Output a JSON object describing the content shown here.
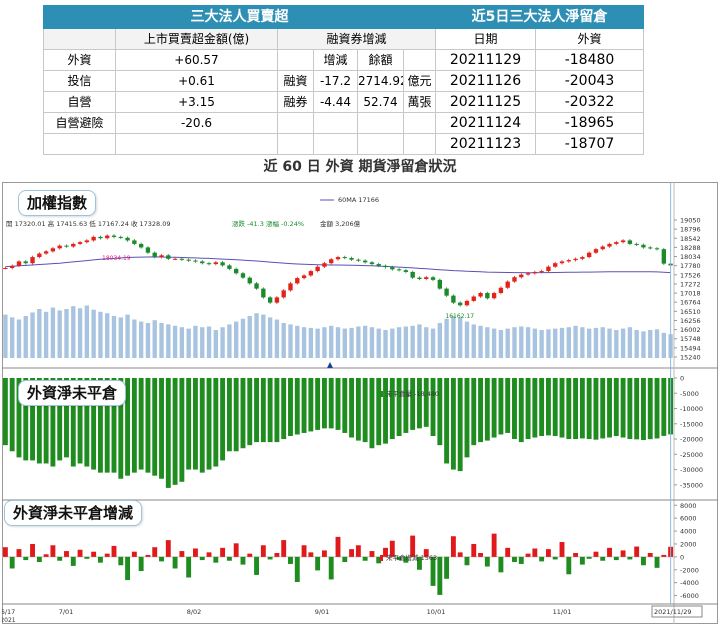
{
  "left_table": {
    "title": "三大法人買賣超",
    "col1_header": "上市買賣超金額(億)",
    "col2_header": "融資券增減",
    "sub_headers": [
      "增減",
      "餘額"
    ],
    "rows": [
      {
        "name": "外資",
        "value": "+60.57",
        "m1": "",
        "m2": "",
        "m3": "",
        "unit": ""
      },
      {
        "name": "投信",
        "value": "+0.61",
        "m1": "融資",
        "m2": "-17.2",
        "m3": "2714.92",
        "unit": "億元"
      },
      {
        "name": "自營",
        "value": "+3.15",
        "m1": "融券",
        "m2": "-4.44",
        "m3": "52.74",
        "unit": "萬張"
      },
      {
        "name": "自營避險",
        "value": "-20.6",
        "m1": "",
        "m2": "",
        "m3": "",
        "unit": ""
      },
      {
        "name": "",
        "value": "",
        "m1": "",
        "m2": "",
        "m3": "",
        "unit": ""
      }
    ]
  },
  "right_table": {
    "title": "近5日三大法人淨留倉",
    "headers": [
      "日期",
      "外資"
    ],
    "rows": [
      [
        "20211129",
        "-18480"
      ],
      [
        "20211126",
        "-20043"
      ],
      [
        "20211125",
        "-20322"
      ],
      [
        "20211124",
        "-18965"
      ],
      [
        "20211123",
        "-18707"
      ]
    ]
  },
  "caption": "近 60 日 外資 期貨淨留倉狀況",
  "chart_data": [
    {
      "type": "candlestick",
      "panel_label": "加權指數",
      "legend": "60MA 17166",
      "info": {
        "open": "開 17320.01",
        "high": "高 17415.63",
        "low": "低 17167.24",
        "close": "收 17328.09",
        "change": "漲跌 -41.3",
        "pct": "漲幅 -0.24%",
        "amount": "金額 3,206億"
      },
      "annotations": [
        {
          "text": "18034.19"
        },
        {
          "text": "16162.17"
        }
      ],
      "y_ticks": [
        "19050",
        "18796",
        "18542",
        "18288",
        "18034",
        "17780",
        "17526",
        "17272",
        "17018",
        "16764",
        "16510",
        "16256",
        "16002",
        "15748",
        "15494",
        "15240"
      ],
      "ylim": [
        15240,
        19050
      ],
      "close": [
        17270,
        17320,
        17420,
        17380,
        17520,
        17600,
        17650,
        17720,
        17780,
        17760,
        17820,
        17860,
        17900,
        17980,
        17950,
        18010,
        17980,
        17960,
        17900,
        17820,
        17740,
        17620,
        17520,
        17560,
        17480,
        17480,
        17460,
        17440,
        17420,
        17380,
        17360,
        17400,
        17330,
        17250,
        17150,
        17050,
        16920,
        16800,
        16600,
        16480,
        16600,
        16760,
        16920,
        17040,
        17100,
        17200,
        17300,
        17380,
        17470,
        17520,
        17500,
        17460,
        17440,
        17400,
        17360,
        17320,
        17290,
        17240,
        17220,
        17180,
        17050,
        17020,
        17060,
        17000,
        16800,
        16640,
        16480,
        16420,
        16520,
        16620,
        16700,
        16580,
        16700,
        16820,
        16960,
        17060,
        17120,
        17150,
        17180,
        17200,
        17300,
        17380,
        17420,
        17450,
        17480,
        17520,
        17620,
        17700,
        17760,
        17820,
        17860,
        17900,
        17820,
        17800,
        17740,
        17720,
        17700,
        17370,
        17328
      ],
      "ma60": [
        17300,
        17310,
        17320,
        17330,
        17340,
        17350,
        17360,
        17370,
        17380,
        17395,
        17410,
        17425,
        17440,
        17455,
        17470,
        17480,
        17490,
        17500,
        17510,
        17515,
        17520,
        17522,
        17524,
        17522,
        17518,
        17514,
        17510,
        17505,
        17500,
        17495,
        17490,
        17482,
        17474,
        17466,
        17458,
        17450,
        17440,
        17430,
        17418,
        17406,
        17394,
        17382,
        17372,
        17362,
        17356,
        17350,
        17345,
        17342,
        17340,
        17338,
        17336,
        17334,
        17330,
        17326,
        17320,
        17314,
        17306,
        17298,
        17290,
        17282,
        17272,
        17262,
        17252,
        17242,
        17232,
        17222,
        17212,
        17204,
        17196,
        17190,
        17184,
        17178,
        17174,
        17170,
        17168,
        17166,
        17165,
        17164,
        17164,
        17165,
        17166,
        17168,
        17170,
        17172,
        17174,
        17176,
        17178,
        17180,
        17182,
        17184,
        17185,
        17186,
        17186,
        17186,
        17185,
        17184,
        17182,
        17175,
        17166
      ],
      "volume": [
        0.62,
        0.58,
        0.55,
        0.6,
        0.65,
        0.7,
        0.66,
        0.72,
        0.68,
        0.7,
        0.74,
        0.71,
        0.75,
        0.69,
        0.66,
        0.64,
        0.6,
        0.58,
        0.62,
        0.55,
        0.52,
        0.5,
        0.54,
        0.5,
        0.48,
        0.46,
        0.44,
        0.42,
        0.46,
        0.44,
        0.45,
        0.4,
        0.44,
        0.48,
        0.52,
        0.56,
        0.6,
        0.64,
        0.62,
        0.58,
        0.55,
        0.5,
        0.48,
        0.46,
        0.44,
        0.43,
        0.42,
        0.44,
        0.46,
        0.44,
        0.42,
        0.43,
        0.45,
        0.46,
        0.44,
        0.42,
        0.4,
        0.42,
        0.44,
        0.45,
        0.46,
        0.48,
        0.44,
        0.42,
        0.5,
        0.56,
        0.6,
        0.58,
        0.52,
        0.48,
        0.46,
        0.44,
        0.42,
        0.4,
        0.42,
        0.44,
        0.45,
        0.44,
        0.42,
        0.4,
        0.41,
        0.42,
        0.43,
        0.44,
        0.46,
        0.44,
        0.42,
        0.43,
        0.44,
        0.42,
        0.4,
        0.42,
        0.44,
        0.4,
        0.38,
        0.4,
        0.41,
        0.36,
        0.34
      ]
    },
    {
      "type": "bar",
      "panel_label": "外資淨未平倉",
      "legend": "未平倉量 -18,480",
      "y_ticks": [
        "0",
        "-5000",
        "-10000",
        "-15000",
        "-20000",
        "-25000",
        "-30000",
        "-35000"
      ],
      "ylim": [
        -38000,
        0
      ],
      "values": [
        -22000,
        -24000,
        -26000,
        -27000,
        -27000,
        -28000,
        -28000,
        -29000,
        -27000,
        -26000,
        -29000,
        -28000,
        -29000,
        -30000,
        -31000,
        -31000,
        -31000,
        -33000,
        -32000,
        -31000,
        -30000,
        -31000,
        -32000,
        -33000,
        -36000,
        -35000,
        -34000,
        -30000,
        -30000,
        -31000,
        -30000,
        -29000,
        -27000,
        -24000,
        -24000,
        -23000,
        -22000,
        -21000,
        -21000,
        -21000,
        -21000,
        -20000,
        -19000,
        -18500,
        -18000,
        -17500,
        -17000,
        -16500,
        -16500,
        -17000,
        -18000,
        -19500,
        -20500,
        -21000,
        -23000,
        -22000,
        -21500,
        -20000,
        -19000,
        -18000,
        -17000,
        -16500,
        -16000,
        -19000,
        -22000,
        -28000,
        -30000,
        -30500,
        -26000,
        -22000,
        -21000,
        -20500,
        -19500,
        -18500,
        -18000,
        -20000,
        -21000,
        -20000,
        -19500,
        -19000,
        -18800,
        -19000,
        -19500,
        -20000,
        -20000,
        -19800,
        -20000,
        -20200,
        -19800,
        -19500,
        -19000,
        -19500,
        -20000,
        -20100,
        -20322,
        -20043,
        -19800,
        -18965,
        -18480
      ]
    },
    {
      "type": "bar",
      "panel_label": "外資淨未平倉增減",
      "legend": "未平倉增減 1563",
      "y_ticks": [
        "8000",
        "6000",
        "4000",
        "2000",
        "0",
        "-2000",
        "-4000",
        "-6000"
      ],
      "ylim": [
        -7000,
        8200
      ],
      "x_ticks": [
        "6/17\n2021",
        "7/01",
        "8/02",
        "9/01",
        "10/01",
        "11/01",
        "2021/11/29"
      ],
      "values": [
        1500,
        -1800,
        1200,
        -500,
        2000,
        -800,
        400,
        1800,
        -600,
        900,
        -1400,
        1100,
        -300,
        800,
        -900,
        500,
        1700,
        -1300,
        -3600,
        800,
        -2200,
        300,
        1500,
        -700,
        2600,
        -1800,
        900,
        -3200,
        1300,
        -500,
        700,
        -900,
        1400,
        -600,
        2100,
        -1200,
        500,
        -2800,
        1800,
        -400,
        600,
        2600,
        -1100,
        -3900,
        1800,
        700,
        -2100,
        1000,
        -3500,
        3100,
        -800,
        1200,
        1800,
        -600,
        900,
        -1000,
        1400,
        2500,
        -500,
        -900,
        3300,
        -2000,
        1200,
        -4500,
        -5900,
        -3400,
        3200,
        700,
        -1300,
        2000,
        600,
        -1500,
        3600,
        -2400,
        1400,
        -800,
        -1100,
        500,
        1300,
        -700,
        1200,
        -400,
        2300,
        -2700,
        600,
        -1200,
        -300,
        800,
        -600,
        1400,
        -500,
        1000,
        -400,
        1600,
        -1300,
        600,
        -1700,
        300,
        1563
      ]
    }
  ]
}
